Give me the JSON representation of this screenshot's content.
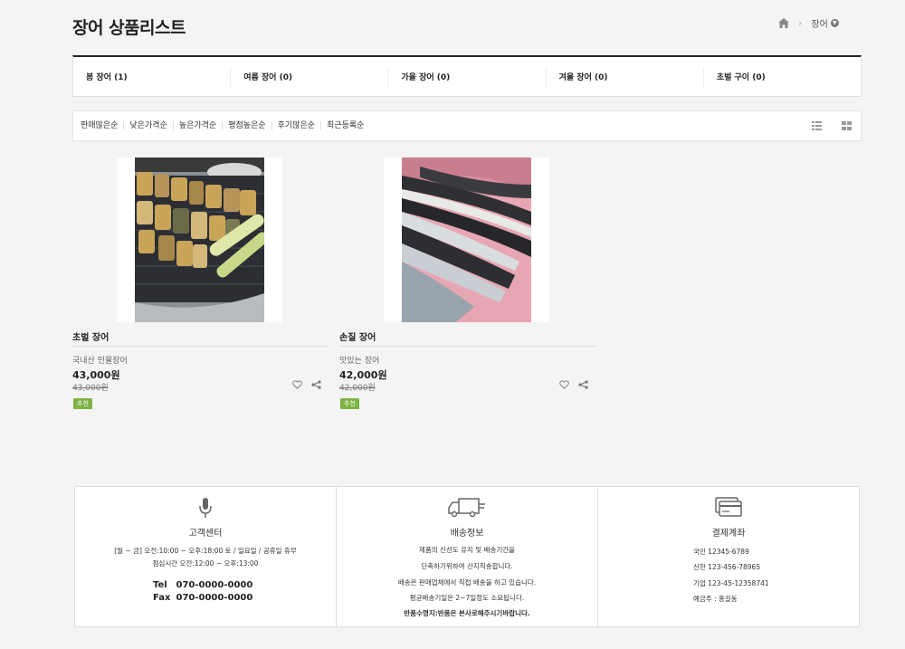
{
  "header": {
    "title": "장어 상품리스트",
    "breadcrumb_current": "장어"
  },
  "categories": [
    {
      "label": "봄 장어 (1)"
    },
    {
      "label": "여름 장어 (0)"
    },
    {
      "label": "가을 장어 (0)"
    },
    {
      "label": "겨울 장어 (0)"
    },
    {
      "label": "초벌 구이 (0)"
    }
  ],
  "sort_options": [
    "판매많은순",
    "낮은가격순",
    "높은가격순",
    "평점높은순",
    "후기많은순",
    "최근등록순"
  ],
  "products": [
    {
      "name": "초벌 장어",
      "desc": "국내산 민물장어",
      "price": "43,000원",
      "original_price": "43,000원",
      "badge": "추천"
    },
    {
      "name": "손질 장어",
      "desc": "맛있는 장어",
      "price": "42,000원",
      "original_price": "42,000원",
      "badge": "추천"
    }
  ],
  "footer": {
    "customer": {
      "title": "고객센터",
      "hours": "[월 ~ 금] 오전:10:00 ~ 오후:18:00   토 / 일요일 / 공휴일 휴무",
      "lunch": "점심시간 오전:12:00 ~ 오후:13:00",
      "tel_label": "Tel",
      "tel": "070-0000-0000",
      "fax_label": "Fax",
      "fax": "070-0000-0000"
    },
    "delivery": {
      "title": "배송정보",
      "lines": [
        "제품의 신선도 유지 및 배송기간을",
        "단축하기위하여  산지직송합니다.",
        "배송은 판매업체에서 직접 배송을 하고 있습니다.",
        "평균배송기일은 2~7일정도 소요됩니다.",
        "반품수령지:반품은 본사로해주시기바랍니다."
      ]
    },
    "payment": {
      "title": "결제계좌",
      "accounts": [
        "국민 12345-6789",
        "신한 123-456-78965",
        "기업 123-45-12358741",
        "예금주 : 홍길동"
      ]
    }
  },
  "colors": {
    "badge": "#7cb342",
    "accent": "#222222"
  }
}
